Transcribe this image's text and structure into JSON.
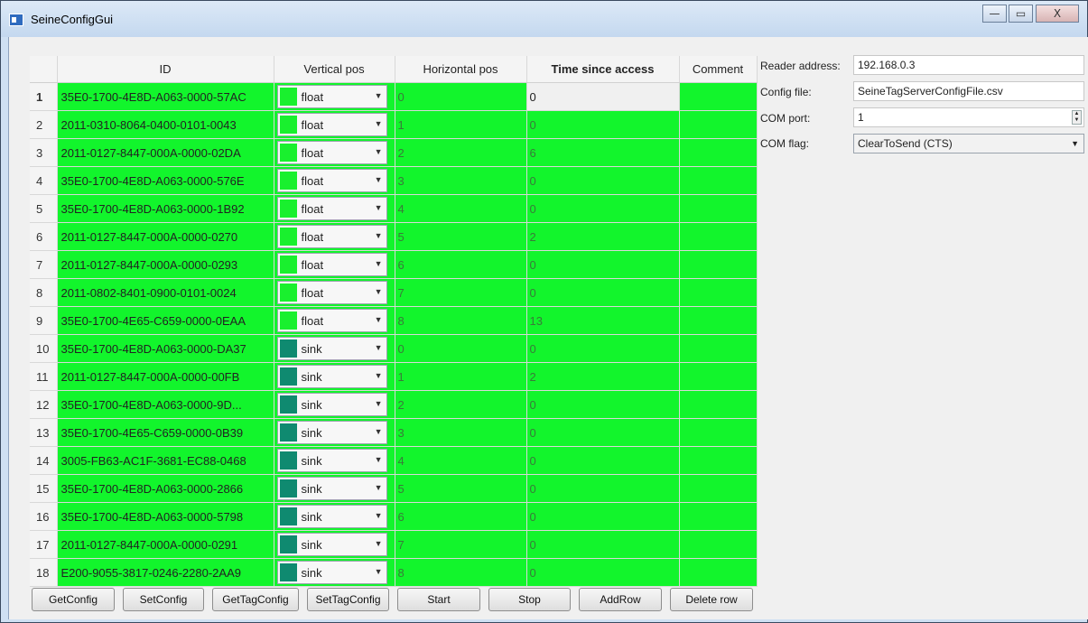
{
  "window": {
    "title": "SeineConfigGui",
    "controls": [
      "—",
      "▭",
      "X"
    ]
  },
  "table": {
    "headers": [
      "ID",
      "Vertical pos",
      "Horizontal pos",
      "Time since access",
      "Comment"
    ],
    "rows": [
      {
        "n": "1",
        "id": "35E0-1700-4E8D-A063-0000-57AC",
        "vpos": "float",
        "hpos": "0",
        "time": "0",
        "comment": ""
      },
      {
        "n": "2",
        "id": "2011-0310-8064-0400-0101-0043",
        "vpos": "float",
        "hpos": "1",
        "time": "0",
        "comment": ""
      },
      {
        "n": "3",
        "id": "2011-0127-8447-000A-0000-02DA",
        "vpos": "float",
        "hpos": "2",
        "time": "6",
        "comment": ""
      },
      {
        "n": "4",
        "id": "35E0-1700-4E8D-A063-0000-576E",
        "vpos": "float",
        "hpos": "3",
        "time": "0",
        "comment": ""
      },
      {
        "n": "5",
        "id": "35E0-1700-4E8D-A063-0000-1B92",
        "vpos": "float",
        "hpos": "4",
        "time": "0",
        "comment": ""
      },
      {
        "n": "6",
        "id": "2011-0127-8447-000A-0000-0270",
        "vpos": "float",
        "hpos": "5",
        "time": "2",
        "comment": ""
      },
      {
        "n": "7",
        "id": "2011-0127-8447-000A-0000-0293",
        "vpos": "float",
        "hpos": "6",
        "time": "0",
        "comment": ""
      },
      {
        "n": "8",
        "id": "2011-0802-8401-0900-0101-0024",
        "vpos": "float",
        "hpos": "7",
        "time": "0",
        "comment": ""
      },
      {
        "n": "9",
        "id": "35E0-1700-4E65-C659-0000-0EAA",
        "vpos": "float",
        "hpos": "8",
        "time": "13",
        "comment": ""
      },
      {
        "n": "10",
        "id": "35E0-1700-4E8D-A063-0000-DA37",
        "vpos": "sink",
        "hpos": "0",
        "time": "0",
        "comment": ""
      },
      {
        "n": "11",
        "id": "2011-0127-8447-000A-0000-00FB",
        "vpos": "sink",
        "hpos": "1",
        "time": "2",
        "comment": ""
      },
      {
        "n": "12",
        "id": "35E0-1700-4E8D-A063-0000-9D...",
        "vpos": "sink",
        "hpos": "2",
        "time": "0",
        "comment": ""
      },
      {
        "n": "13",
        "id": "35E0-1700-4E65-C659-0000-0B39",
        "vpos": "sink",
        "hpos": "3",
        "time": "0",
        "comment": ""
      },
      {
        "n": "14",
        "id": "3005-FB63-AC1F-3681-EC88-0468",
        "vpos": "sink",
        "hpos": "4",
        "time": "0",
        "comment": ""
      },
      {
        "n": "15",
        "id": "35E0-1700-4E8D-A063-0000-2866",
        "vpos": "sink",
        "hpos": "5",
        "time": "0",
        "comment": ""
      },
      {
        "n": "16",
        "id": "35E0-1700-4E8D-A063-0000-5798",
        "vpos": "sink",
        "hpos": "6",
        "time": "0",
        "comment": ""
      },
      {
        "n": "17",
        "id": "2011-0127-8447-000A-0000-0291",
        "vpos": "sink",
        "hpos": "7",
        "time": "0",
        "comment": ""
      },
      {
        "n": "18",
        "id": "E200-9055-3817-0246-2280-2AA9",
        "vpos": "sink",
        "hpos": "8",
        "time": "0",
        "comment": ""
      }
    ]
  },
  "colors": {
    "row_green": "#12f52c",
    "float_swatch": "#19f02e",
    "sink_swatch": "#0f8a70"
  },
  "buttons": [
    "GetConfig",
    "SetConfig",
    "GetTagConfig",
    "SetTagConfig",
    "Start",
    "Stop",
    "AddRow",
    "Delete row"
  ],
  "settings": {
    "reader_address_label": "Reader address:",
    "reader_address": "192.168.0.3",
    "config_file_label": "Config file:",
    "config_file": "SeineTagServerConfigFile.csv",
    "com_port_label": "COM port:",
    "com_port": "1",
    "com_flag_label": "COM flag:",
    "com_flag": "ClearToSend (CTS)"
  }
}
